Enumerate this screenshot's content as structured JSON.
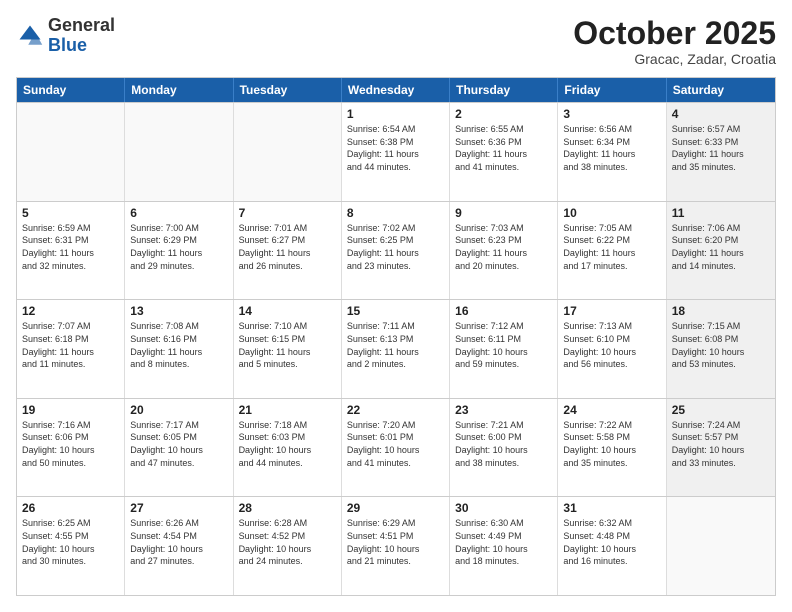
{
  "logo": {
    "general": "General",
    "blue": "Blue"
  },
  "header": {
    "month": "October 2025",
    "location": "Gracac, Zadar, Croatia"
  },
  "days": [
    "Sunday",
    "Monday",
    "Tuesday",
    "Wednesday",
    "Thursday",
    "Friday",
    "Saturday"
  ],
  "rows": [
    [
      {
        "day": "",
        "lines": []
      },
      {
        "day": "",
        "lines": []
      },
      {
        "day": "",
        "lines": []
      },
      {
        "day": "1",
        "lines": [
          "Sunrise: 6:54 AM",
          "Sunset: 6:38 PM",
          "Daylight: 11 hours",
          "and 44 minutes."
        ]
      },
      {
        "day": "2",
        "lines": [
          "Sunrise: 6:55 AM",
          "Sunset: 6:36 PM",
          "Daylight: 11 hours",
          "and 41 minutes."
        ]
      },
      {
        "day": "3",
        "lines": [
          "Sunrise: 6:56 AM",
          "Sunset: 6:34 PM",
          "Daylight: 11 hours",
          "and 38 minutes."
        ]
      },
      {
        "day": "4",
        "lines": [
          "Sunrise: 6:57 AM",
          "Sunset: 6:33 PM",
          "Daylight: 11 hours",
          "and 35 minutes."
        ]
      }
    ],
    [
      {
        "day": "5",
        "lines": [
          "Sunrise: 6:59 AM",
          "Sunset: 6:31 PM",
          "Daylight: 11 hours",
          "and 32 minutes."
        ]
      },
      {
        "day": "6",
        "lines": [
          "Sunrise: 7:00 AM",
          "Sunset: 6:29 PM",
          "Daylight: 11 hours",
          "and 29 minutes."
        ]
      },
      {
        "day": "7",
        "lines": [
          "Sunrise: 7:01 AM",
          "Sunset: 6:27 PM",
          "Daylight: 11 hours",
          "and 26 minutes."
        ]
      },
      {
        "day": "8",
        "lines": [
          "Sunrise: 7:02 AM",
          "Sunset: 6:25 PM",
          "Daylight: 11 hours",
          "and 23 minutes."
        ]
      },
      {
        "day": "9",
        "lines": [
          "Sunrise: 7:03 AM",
          "Sunset: 6:23 PM",
          "Daylight: 11 hours",
          "and 20 minutes."
        ]
      },
      {
        "day": "10",
        "lines": [
          "Sunrise: 7:05 AM",
          "Sunset: 6:22 PM",
          "Daylight: 11 hours",
          "and 17 minutes."
        ]
      },
      {
        "day": "11",
        "lines": [
          "Sunrise: 7:06 AM",
          "Sunset: 6:20 PM",
          "Daylight: 11 hours",
          "and 14 minutes."
        ]
      }
    ],
    [
      {
        "day": "12",
        "lines": [
          "Sunrise: 7:07 AM",
          "Sunset: 6:18 PM",
          "Daylight: 11 hours",
          "and 11 minutes."
        ]
      },
      {
        "day": "13",
        "lines": [
          "Sunrise: 7:08 AM",
          "Sunset: 6:16 PM",
          "Daylight: 11 hours",
          "and 8 minutes."
        ]
      },
      {
        "day": "14",
        "lines": [
          "Sunrise: 7:10 AM",
          "Sunset: 6:15 PM",
          "Daylight: 11 hours",
          "and 5 minutes."
        ]
      },
      {
        "day": "15",
        "lines": [
          "Sunrise: 7:11 AM",
          "Sunset: 6:13 PM",
          "Daylight: 11 hours",
          "and 2 minutes."
        ]
      },
      {
        "day": "16",
        "lines": [
          "Sunrise: 7:12 AM",
          "Sunset: 6:11 PM",
          "Daylight: 10 hours",
          "and 59 minutes."
        ]
      },
      {
        "day": "17",
        "lines": [
          "Sunrise: 7:13 AM",
          "Sunset: 6:10 PM",
          "Daylight: 10 hours",
          "and 56 minutes."
        ]
      },
      {
        "day": "18",
        "lines": [
          "Sunrise: 7:15 AM",
          "Sunset: 6:08 PM",
          "Daylight: 10 hours",
          "and 53 minutes."
        ]
      }
    ],
    [
      {
        "day": "19",
        "lines": [
          "Sunrise: 7:16 AM",
          "Sunset: 6:06 PM",
          "Daylight: 10 hours",
          "and 50 minutes."
        ]
      },
      {
        "day": "20",
        "lines": [
          "Sunrise: 7:17 AM",
          "Sunset: 6:05 PM",
          "Daylight: 10 hours",
          "and 47 minutes."
        ]
      },
      {
        "day": "21",
        "lines": [
          "Sunrise: 7:18 AM",
          "Sunset: 6:03 PM",
          "Daylight: 10 hours",
          "and 44 minutes."
        ]
      },
      {
        "day": "22",
        "lines": [
          "Sunrise: 7:20 AM",
          "Sunset: 6:01 PM",
          "Daylight: 10 hours",
          "and 41 minutes."
        ]
      },
      {
        "day": "23",
        "lines": [
          "Sunrise: 7:21 AM",
          "Sunset: 6:00 PM",
          "Daylight: 10 hours",
          "and 38 minutes."
        ]
      },
      {
        "day": "24",
        "lines": [
          "Sunrise: 7:22 AM",
          "Sunset: 5:58 PM",
          "Daylight: 10 hours",
          "and 35 minutes."
        ]
      },
      {
        "day": "25",
        "lines": [
          "Sunrise: 7:24 AM",
          "Sunset: 5:57 PM",
          "Daylight: 10 hours",
          "and 33 minutes."
        ]
      }
    ],
    [
      {
        "day": "26",
        "lines": [
          "Sunrise: 6:25 AM",
          "Sunset: 4:55 PM",
          "Daylight: 10 hours",
          "and 30 minutes."
        ]
      },
      {
        "day": "27",
        "lines": [
          "Sunrise: 6:26 AM",
          "Sunset: 4:54 PM",
          "Daylight: 10 hours",
          "and 27 minutes."
        ]
      },
      {
        "day": "28",
        "lines": [
          "Sunrise: 6:28 AM",
          "Sunset: 4:52 PM",
          "Daylight: 10 hours",
          "and 24 minutes."
        ]
      },
      {
        "day": "29",
        "lines": [
          "Sunrise: 6:29 AM",
          "Sunset: 4:51 PM",
          "Daylight: 10 hours",
          "and 21 minutes."
        ]
      },
      {
        "day": "30",
        "lines": [
          "Sunrise: 6:30 AM",
          "Sunset: 4:49 PM",
          "Daylight: 10 hours",
          "and 18 minutes."
        ]
      },
      {
        "day": "31",
        "lines": [
          "Sunrise: 6:32 AM",
          "Sunset: 4:48 PM",
          "Daylight: 10 hours",
          "and 16 minutes."
        ]
      },
      {
        "day": "",
        "lines": []
      }
    ]
  ]
}
